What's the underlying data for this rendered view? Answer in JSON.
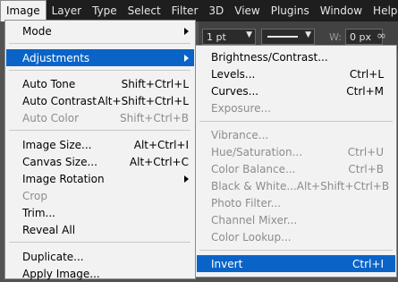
{
  "menubar": {
    "items": [
      "Image",
      "Layer",
      "Type",
      "Select",
      "Filter",
      "3D",
      "View",
      "Plugins",
      "Window",
      "Help"
    ]
  },
  "options_bar": {
    "stroke_width": "1 pt",
    "width_label": "W:",
    "width_value": "0 px"
  },
  "image_menu": {
    "mode": {
      "label": "Mode"
    },
    "adjustments": {
      "label": "Adjustments"
    },
    "auto_tone": {
      "label": "Auto Tone",
      "shortcut": "Shift+Ctrl+L"
    },
    "auto_contrast": {
      "label": "Auto Contrast",
      "shortcut": "Alt+Shift+Ctrl+L"
    },
    "auto_color": {
      "label": "Auto Color",
      "shortcut": "Shift+Ctrl+B"
    },
    "image_size": {
      "label": "Image Size...",
      "shortcut": "Alt+Ctrl+I"
    },
    "canvas_size": {
      "label": "Canvas Size...",
      "shortcut": "Alt+Ctrl+C"
    },
    "image_rotation": {
      "label": "Image Rotation"
    },
    "crop": {
      "label": "Crop"
    },
    "trim": {
      "label": "Trim..."
    },
    "reveal_all": {
      "label": "Reveal All"
    },
    "duplicate": {
      "label": "Duplicate..."
    },
    "apply_image": {
      "label": "Apply Image..."
    }
  },
  "adjustments_menu": {
    "brightness_contrast": {
      "label": "Brightness/Contrast..."
    },
    "levels": {
      "label": "Levels...",
      "shortcut": "Ctrl+L"
    },
    "curves": {
      "label": "Curves...",
      "shortcut": "Ctrl+M"
    },
    "exposure": {
      "label": "Exposure..."
    },
    "vibrance": {
      "label": "Vibrance..."
    },
    "hue_saturation": {
      "label": "Hue/Saturation...",
      "shortcut": "Ctrl+U"
    },
    "color_balance": {
      "label": "Color Balance...",
      "shortcut": "Ctrl+B"
    },
    "black_white": {
      "label": "Black & White...",
      "shortcut": "Alt+Shift+Ctrl+B"
    },
    "photo_filter": {
      "label": "Photo Filter..."
    },
    "channel_mixer": {
      "label": "Channel Mixer..."
    },
    "color_lookup": {
      "label": "Color Lookup..."
    },
    "invert": {
      "label": "Invert",
      "shortcut": "Ctrl+I"
    }
  },
  "colors": {
    "menubar_bg": "#1e1e1e",
    "menu_bg": "#f2f2f2",
    "highlight": "#0a64c8",
    "disabled_text": "#8c8c8c"
  }
}
